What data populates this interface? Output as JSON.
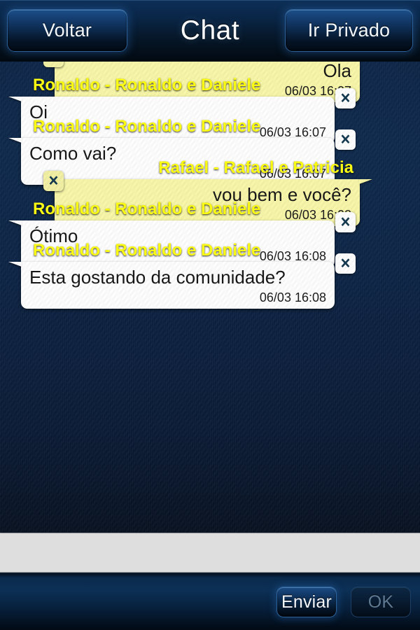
{
  "header": {
    "back_label": "Voltar",
    "title": "Chat",
    "private_label": "Ir Privado"
  },
  "messages": [
    {
      "side": "me",
      "sender": "",
      "text": "Ola",
      "time": "06/03 16:07",
      "close_icon": "close-x-icon"
    },
    {
      "side": "them",
      "sender": "Ronaldo - Ronaldo e Daniele",
      "text": "Oi",
      "time": "06/03 16:07",
      "close_icon": "close-x-icon"
    },
    {
      "side": "them",
      "sender": "Ronaldo - Ronaldo e Daniele",
      "text": "Como vai?",
      "time": "06/03 16:07",
      "close_icon": "close-x-icon"
    },
    {
      "side": "me",
      "sender": "Rafael - Rafael e Patricia",
      "text": "vou bem e você?",
      "time": "06/03 16:08",
      "close_icon": "close-x-icon"
    },
    {
      "side": "them",
      "sender": "Ronaldo - Ronaldo e Daniele",
      "text": "Ótimo",
      "time": "06/03 16:08",
      "close_icon": "close-x-icon"
    },
    {
      "side": "them",
      "sender": "Ronaldo - Ronaldo e Daniele",
      "text": "Esta gostando da comunidade?",
      "time": "06/03 16:08",
      "close_icon": "close-x-icon"
    }
  ],
  "composer": {
    "value": "",
    "placeholder": ""
  },
  "footer": {
    "send_label": "Enviar",
    "ok_label": "OK"
  },
  "colors": {
    "outgoing_bubble": "#f8f7a8",
    "incoming_bubble": "#ffffff",
    "sender_name": "#ffff12",
    "background": "#0a2244",
    "header": "#0a2647",
    "input_field": "#dedede"
  }
}
